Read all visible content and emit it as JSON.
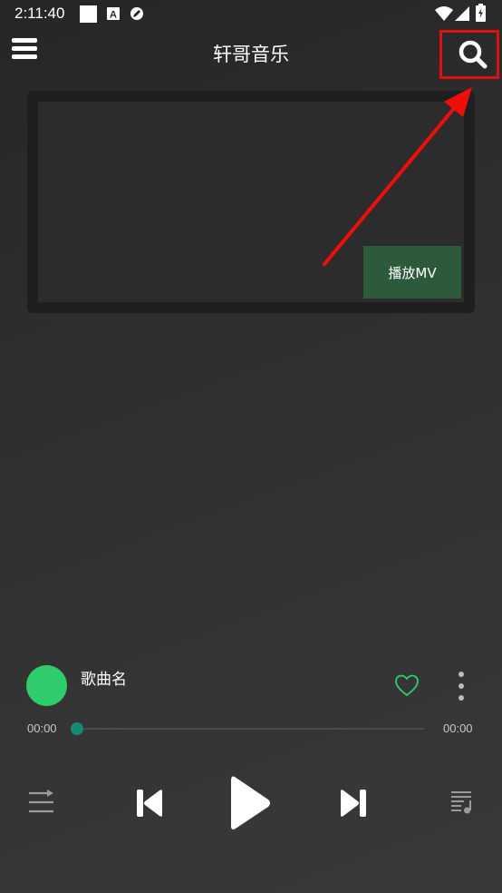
{
  "status_bar": {
    "time": "2:11:40",
    "icons": [
      "square-icon",
      "a-box-icon",
      "edit-icon",
      "wifi-icon",
      "signal-icon",
      "battery-icon"
    ]
  },
  "app_bar": {
    "title": "轩哥音乐",
    "menu_icon": "menu-icon",
    "search_icon": "search-icon"
  },
  "annotation": {
    "highlight_color": "#e01010",
    "target": "search-button"
  },
  "mv": {
    "play_button_label": "播放MV"
  },
  "player": {
    "song_name": "歌曲名",
    "current_time": "00:00",
    "total_time": "00:00",
    "progress": 0,
    "liked": false,
    "accent_color": "#2ecc6a",
    "controls": [
      "repeat-icon",
      "previous-icon",
      "play-icon",
      "next-icon",
      "playlist-icon"
    ]
  }
}
